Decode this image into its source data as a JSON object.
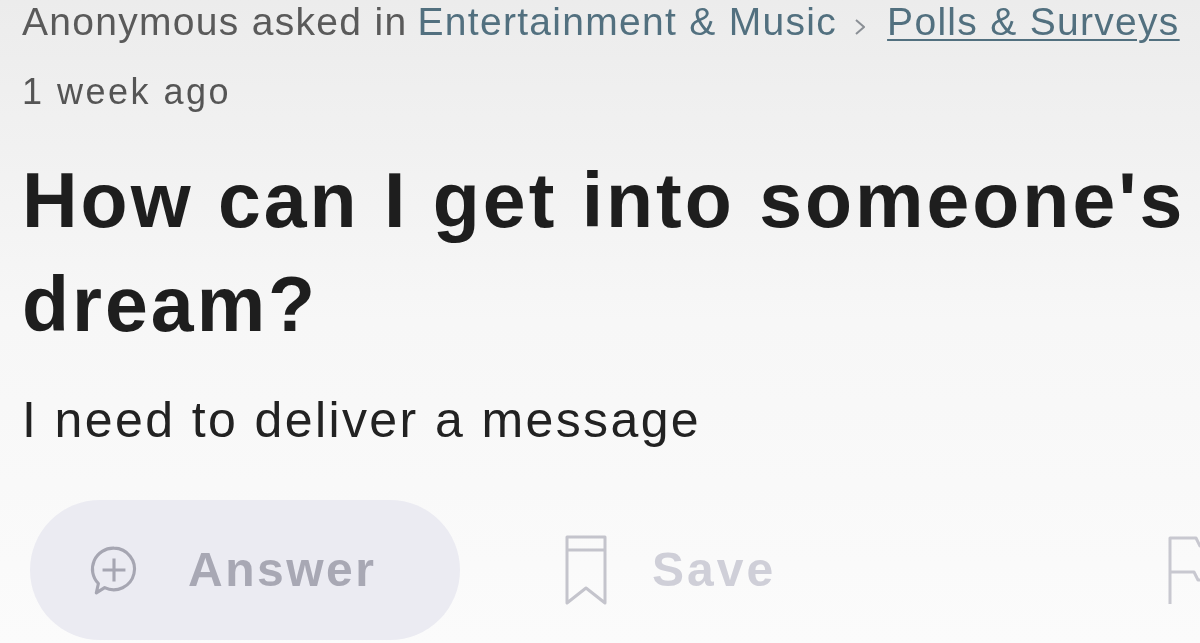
{
  "breadcrumb": {
    "author_text": "Anonymous asked in",
    "category": "Entertainment & Music",
    "subcategory": "Polls & Surveys"
  },
  "time": "1 week ago",
  "question": {
    "title": "How can I get into someone's dream?",
    "details": "I need to deliver a message"
  },
  "actions": [
    {
      "kind": "answer",
      "label": "Answer"
    },
    {
      "kind": "save",
      "label": "Save"
    },
    {
      "kind": "report"
    }
  ]
}
